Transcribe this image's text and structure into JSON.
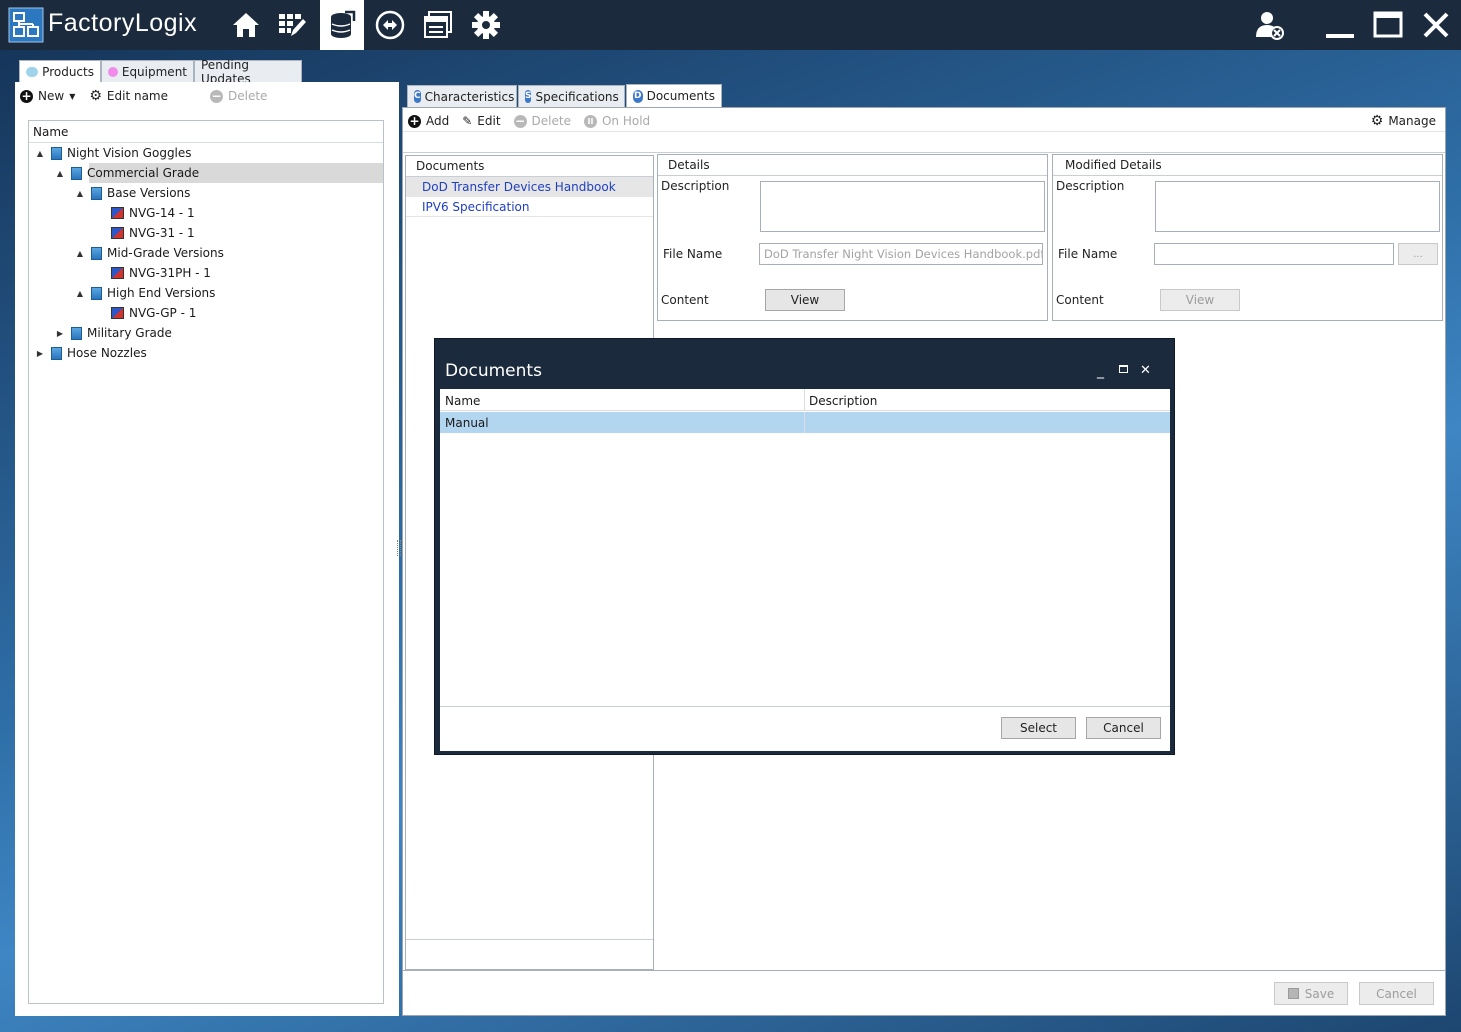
{
  "app": {
    "title": "FactoryLogix",
    "nav_icons": [
      "home-icon",
      "grid-edit-icon",
      "product-database-icon",
      "routing-icon",
      "report-window-icon",
      "settings-gear-icon"
    ],
    "window_controls": [
      "user-logout-icon",
      "minimize-icon",
      "maximize-icon",
      "close-icon"
    ]
  },
  "left": {
    "tabs": [
      {
        "label": "Products",
        "color": "#9fd3ea"
      },
      {
        "label": "Equipment",
        "color": "#f08bea"
      },
      {
        "label": "Pending Updates"
      }
    ],
    "toolbar": {
      "new": "New",
      "edit_name": "Edit name",
      "delete": "Delete"
    },
    "tree_header": "Name",
    "tree": [
      {
        "label": "Night Vision Goggles",
        "expander": "▲",
        "icon": "folder"
      },
      {
        "label": "Commercial Grade",
        "expander": "▲",
        "icon": "folder"
      },
      {
        "label": "Base Versions",
        "expander": "▲",
        "icon": "folder"
      },
      {
        "label": "NVG-14 - 1",
        "expander": "",
        "icon": "part"
      },
      {
        "label": "NVG-31 - 1",
        "expander": "",
        "icon": "part"
      },
      {
        "label": "Mid-Grade Versions",
        "expander": "▲",
        "icon": "folder"
      },
      {
        "label": "NVG-31PH - 1",
        "expander": "",
        "icon": "part"
      },
      {
        "label": "High End Versions",
        "expander": "▲",
        "icon": "folder"
      },
      {
        "label": "NVG-GP - 1",
        "expander": "",
        "icon": "part"
      },
      {
        "label": "Military Grade",
        "expander": "▶",
        "icon": "folder"
      },
      {
        "label": "Hose Nozzles",
        "expander": "▶",
        "icon": "folder"
      }
    ]
  },
  "right": {
    "tabs": [
      {
        "label": "Characteristics",
        "badge": "C"
      },
      {
        "label": "Specifications",
        "badge": "S"
      },
      {
        "label": "Documents",
        "badge": "D"
      }
    ],
    "toolbar": {
      "add": "Add",
      "edit": "Edit",
      "delete": "Delete",
      "on_hold": "On Hold",
      "manage": "Manage"
    },
    "documents": {
      "header": "Documents",
      "items": [
        "DoD Transfer Devices Handbook",
        "IPV6 Specification"
      ]
    },
    "details": {
      "header": "Details",
      "description_label": "Description",
      "file_name_label": "File Name",
      "file_name_value": "DoD Transfer Night Vision Devices Handbook.pdf",
      "content_label": "Content",
      "view_button": "View"
    },
    "modified_details": {
      "header": "Modified Details",
      "description_label": "Description",
      "file_name_label": "File Name",
      "browse_button": "...",
      "content_label": "Content",
      "view_button": "View"
    },
    "footer": {
      "save": "Save",
      "cancel": "Cancel"
    }
  },
  "dialog": {
    "title": "Documents",
    "columns": [
      "Name",
      "Description"
    ],
    "rows": [
      {
        "name": "Manual",
        "description": ""
      }
    ],
    "select_button": "Select",
    "cancel_button": "Cancel"
  }
}
